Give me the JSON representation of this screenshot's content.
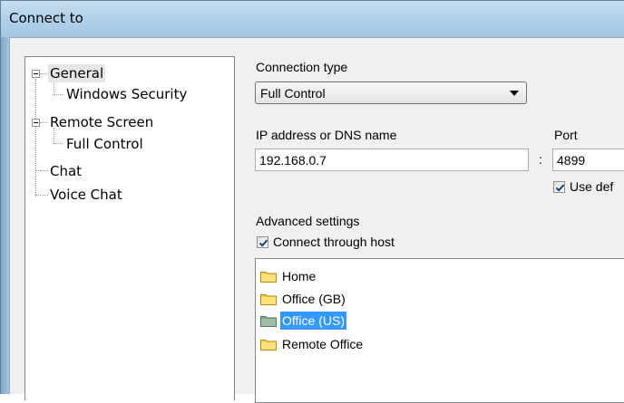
{
  "window": {
    "title": "Connect to"
  },
  "tree": {
    "items": [
      {
        "label": "General"
      },
      {
        "label": "Windows Security"
      },
      {
        "label": "Remote Screen"
      },
      {
        "label": "Full Control"
      },
      {
        "label": "Chat"
      },
      {
        "label": "Voice Chat"
      }
    ],
    "selected": "General"
  },
  "connection": {
    "type_label": "Connection type",
    "type_value": "Full Control",
    "address_label": "IP address or DNS name",
    "address_value": "192.168.0.7",
    "separator": ":",
    "port_label": "Port",
    "port_value": "4899",
    "use_default_label": "Use def",
    "use_default_checked": true
  },
  "advanced": {
    "label": "Advanced settings",
    "through_host_label": "Connect through host",
    "through_host_checked": true
  },
  "hosts": {
    "items": [
      {
        "label": "Home",
        "icon": "folder-icon"
      },
      {
        "label": "Office (GB)",
        "icon": "folder-icon"
      },
      {
        "label": "Office (US)",
        "icon": "folder-icon"
      },
      {
        "label": "Remote Office",
        "icon": "folder-icon"
      }
    ],
    "selected": "Office (US)"
  },
  "colors": {
    "selection": "#3399ff",
    "folder": "#f5d04a",
    "folder_selected": "#7fa88a"
  }
}
